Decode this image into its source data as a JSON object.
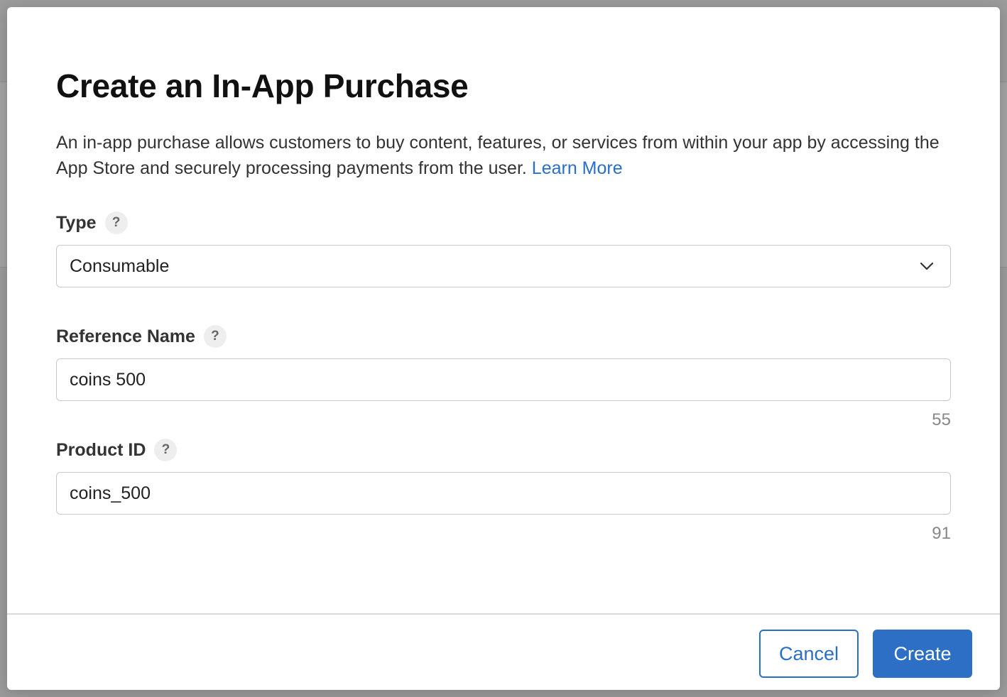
{
  "dialog": {
    "title": "Create an In-App Purchase",
    "description": "An in-app purchase allows customers to buy content, features, or services from within your app by accessing the App Store and securely processing payments from the user.",
    "learn_more": "Learn More"
  },
  "fields": {
    "type": {
      "label": "Type",
      "help": "?",
      "value": "Consumable",
      "icon": "chevron-down-icon"
    },
    "reference_name": {
      "label": "Reference Name",
      "help": "?",
      "value": "coins 500",
      "remaining": "55"
    },
    "product_id": {
      "label": "Product ID",
      "help": "?",
      "value": "coins_500",
      "remaining": "91"
    }
  },
  "footer": {
    "cancel_label": "Cancel",
    "create_label": "Create"
  },
  "colors": {
    "accent": "#2a6fc6",
    "primary_button": "#2d6fc4",
    "backdrop": "#9b9b9b"
  }
}
